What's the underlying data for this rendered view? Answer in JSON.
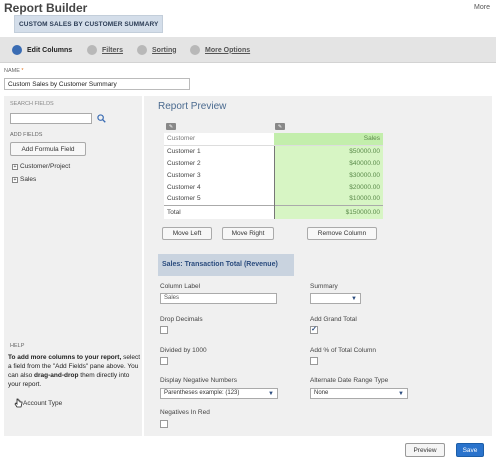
{
  "header": {
    "title": "Report Builder",
    "more_link": "More",
    "subtitle": "CUSTOM SALES BY CUSTOMER SUMMARY"
  },
  "tabs": [
    {
      "label": "Edit Columns",
      "active": true
    },
    {
      "label": "Filters",
      "active": false
    },
    {
      "label": "Sorting",
      "active": false
    },
    {
      "label": "More Options",
      "active": false
    }
  ],
  "name_field": {
    "label": "NAME",
    "required_mark": "*",
    "value": "Custom Sales by Customer Summary"
  },
  "left_panel": {
    "search_label": "SEARCH FIELDS",
    "search_value": "",
    "add_fields_label": "ADD FIELDS",
    "formula_button": "Add Formula Field",
    "tree": [
      "Customer/Project",
      "Sales"
    ],
    "help_label": "HELP",
    "help_bold_1": "To add more columns to your report,",
    "help_text_1": " select a field from the \"Add Fields\" pane above. You can also ",
    "help_bold_2": "drag-and-drop",
    "help_text_2": " them directly into your report.",
    "drag_item": "Account Type"
  },
  "preview": {
    "title": "Report Preview",
    "columns": [
      "Customer",
      "Sales"
    ],
    "rows": [
      [
        "Customer 1",
        "$50000.00"
      ],
      [
        "Customer 2",
        "$40000.00"
      ],
      [
        "Customer 3",
        "$30000.00"
      ],
      [
        "Customer 4",
        "$20000.00"
      ],
      [
        "Customer 5",
        "$10000.00"
      ]
    ],
    "total_row": [
      "Total",
      "$150000.00"
    ],
    "move_left": "Move Left",
    "move_right": "Move Right",
    "remove_column": "Remove Column"
  },
  "column_settings": {
    "header": "Sales: Transaction Total (Revenue)",
    "column_label_label": "Column Label",
    "column_label_value": "Sales",
    "summary_label": "Summary",
    "summary_value": "",
    "drop_decimals_label": "Drop Decimals",
    "drop_decimals_checked": false,
    "add_grand_total_label": "Add Grand Total",
    "add_grand_total_checked": true,
    "divided_by_1000_label": "Divided by 1000",
    "divided_by_1000_checked": false,
    "add_pct_total_label": "Add % of Total Column",
    "add_pct_total_checked": false,
    "display_negative_label": "Display Negative Numbers",
    "display_negative_value": "Parentheses  example: (123)",
    "alt_date_range_label": "Alternate Date Range Type",
    "alt_date_range_value": "None",
    "negatives_in_red_label": "Negatives In Red",
    "negatives_in_red_checked": false
  },
  "footer": {
    "preview_button": "Preview",
    "save_button": "Save"
  },
  "colors": {
    "accent": "#2a73cc",
    "active_tab_dot": "#3a6cb3",
    "sales_column": "#d7f5c4",
    "column_header_bg": "#c9d3df"
  },
  "icons": {
    "search": "magnifier-icon",
    "plus": "expand-plus-icon",
    "drag": "hand-cursor-icon",
    "caret": "chevron-down-icon"
  }
}
